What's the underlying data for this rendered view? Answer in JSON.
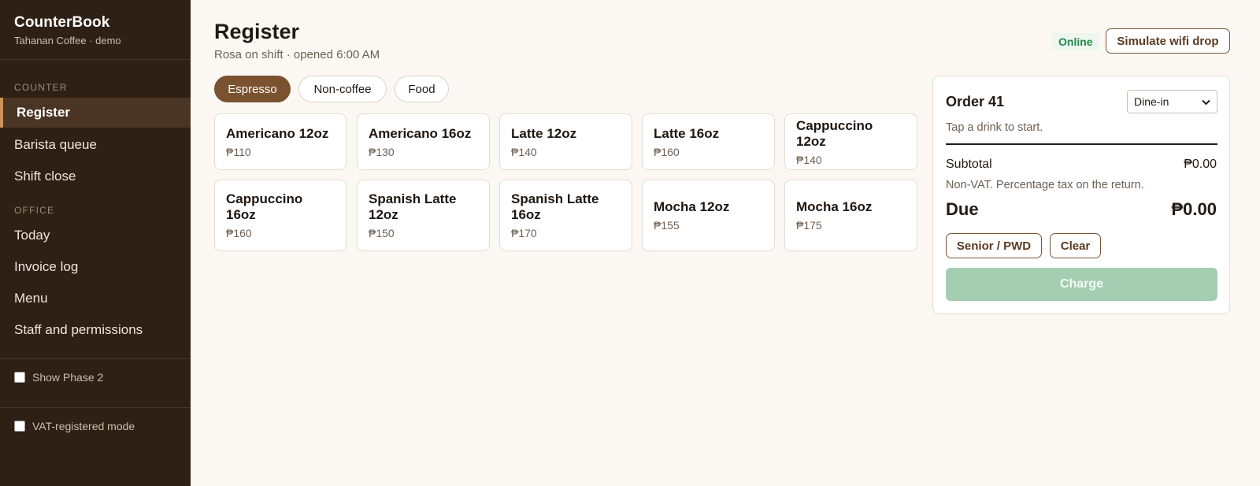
{
  "sidebar": {
    "brand": {
      "name": "CounterBook",
      "sub": "Tahanan Coffee · demo"
    },
    "sections": [
      {
        "label": "COUNTER",
        "items": [
          "Register",
          "Barista queue",
          "Shift close"
        ]
      },
      {
        "label": "OFFICE",
        "items": [
          "Today",
          "Invoice log",
          "Menu",
          "Staff and permissions"
        ]
      }
    ],
    "active_item": "Register",
    "toggles": [
      {
        "label": "Show Phase 2",
        "checked": false
      },
      {
        "label": "VAT-registered mode",
        "checked": false
      }
    ]
  },
  "header": {
    "title": "Register",
    "subtitle": "Rosa on shift · opened 6:00 AM",
    "status": "Online",
    "wifi_button": "Simulate wifi drop"
  },
  "categories": {
    "tabs": [
      "Espresso",
      "Non-coffee",
      "Food"
    ],
    "active": "Espresso"
  },
  "products": [
    {
      "name": "Americano 12oz",
      "price": "₱110"
    },
    {
      "name": "Americano 16oz",
      "price": "₱130"
    },
    {
      "name": "Latte 12oz",
      "price": "₱140"
    },
    {
      "name": "Latte 16oz",
      "price": "₱160"
    },
    {
      "name": "Cappuccino 12oz",
      "price": "₱140"
    },
    {
      "name": "Cappuccino 16oz",
      "price": "₱160"
    },
    {
      "name": "Spanish Latte 12oz",
      "price": "₱150"
    },
    {
      "name": "Spanish Latte 16oz",
      "price": "₱170"
    },
    {
      "name": "Mocha 12oz",
      "price": "₱155"
    },
    {
      "name": "Mocha 16oz",
      "price": "₱175"
    }
  ],
  "order": {
    "title": "Order 41",
    "service_type": "Dine-in",
    "hint": "Tap a drink to start.",
    "subtotal_label": "Subtotal",
    "subtotal_value": "₱0.00",
    "tax_note": "Non-VAT. Percentage tax on the return.",
    "due_label": "Due",
    "due_value": "₱0.00",
    "senior_button": "Senior / PWD",
    "clear_button": "Clear",
    "charge_button": "Charge"
  },
  "colors": {
    "sidebar_bg": "#2e2015",
    "accent": "#7a5230",
    "online": "#1f8a48",
    "charge_disabled": "#a4cdb2"
  }
}
